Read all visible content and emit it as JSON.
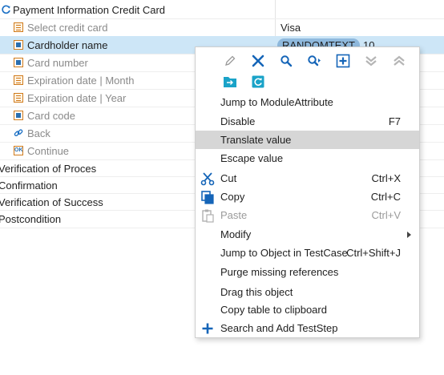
{
  "tree": {
    "rows": [
      {
        "label": "Payment Information Credit Card",
        "value": ""
      },
      {
        "label": "Select credit card",
        "value": "Visa"
      },
      {
        "label": "Cardholder name",
        "value_pill": "RANDOMTEXT",
        "value_extra": "10"
      },
      {
        "label": "Card number"
      },
      {
        "label": "Expiration date | Month"
      },
      {
        "label": "Expiration date | Year"
      },
      {
        "label": "Card code"
      },
      {
        "label": "Back"
      },
      {
        "label": "Continue"
      },
      {
        "label": "Verification of Proces"
      },
      {
        "label": "Confirmation"
      },
      {
        "label": "Verification of Success"
      },
      {
        "label": "Postcondition"
      }
    ]
  },
  "menu": {
    "toolbar": [
      "edit-icon",
      "delete-icon",
      "search-icon",
      "search-next-icon",
      "add-icon",
      "collapse-icon",
      "expand-icon",
      "move-icon",
      "refresh-icon"
    ],
    "items": [
      {
        "label": "Jump to ModuleAttribute",
        "shortcut": ""
      },
      {
        "label": "Disable",
        "shortcut": "F7"
      },
      {
        "label": "Translate value",
        "shortcut": ""
      },
      {
        "label": "Escape value",
        "shortcut": ""
      },
      {
        "label": "Cut",
        "shortcut": "Ctrl+X"
      },
      {
        "label": "Copy",
        "shortcut": "Ctrl+C"
      },
      {
        "label": "Paste",
        "shortcut": "Ctrl+V"
      },
      {
        "label": "Modify",
        "shortcut": ""
      },
      {
        "label": "Jump to Object in TestCase",
        "shortcut": "Ctrl+Shift+J"
      },
      {
        "label": "Purge missing references",
        "shortcut": ""
      },
      {
        "label": "Drag this object",
        "shortcut": ""
      },
      {
        "label": "Copy table to clipboard",
        "shortcut": ""
      },
      {
        "label": "Search and Add TestStep",
        "shortcut": ""
      }
    ]
  },
  "colors": {
    "accent": "#1a6fc4",
    "selection": "#cde6f7",
    "menu_highlight": "#d6d6d6"
  }
}
